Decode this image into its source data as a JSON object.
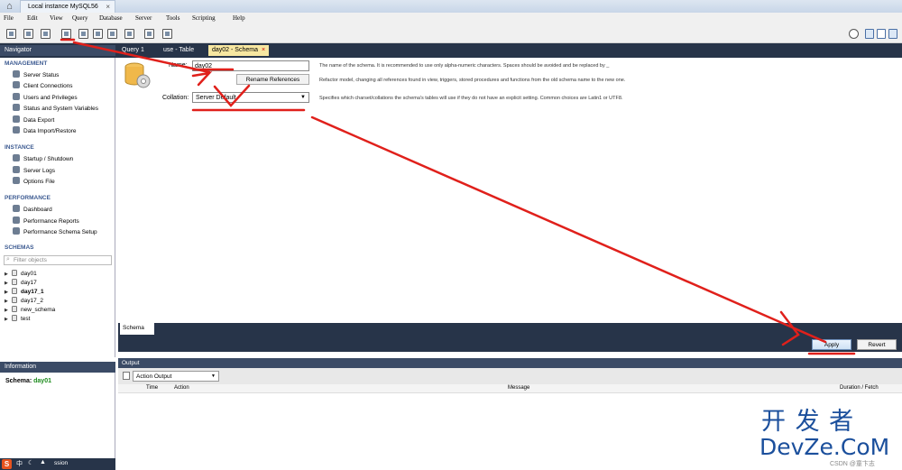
{
  "window": {
    "tab_title": "Local instance MySQL56",
    "close_glyph": "×"
  },
  "menu": [
    "File",
    "Edit",
    "View",
    "Query",
    "Database",
    "Server",
    "Tools",
    "Scripting",
    "Help"
  ],
  "doc_tabs": [
    {
      "label": "Query 1",
      "active": false
    },
    {
      "label": "use - Table",
      "active": false
    },
    {
      "label": "day02 - Schema",
      "active": true
    }
  ],
  "navigator": {
    "title": "Navigator",
    "management": {
      "title": "MANAGEMENT",
      "items": [
        "Server Status",
        "Client Connections",
        "Users and Privileges",
        "Status and System Variables",
        "Data Export",
        "Data Import/Restore"
      ]
    },
    "instance": {
      "title": "INSTANCE",
      "items": [
        "Startup / Shutdown",
        "Server Logs",
        "Options File"
      ]
    },
    "performance": {
      "title": "PERFORMANCE",
      "items": [
        "Dashboard",
        "Performance Reports",
        "Performance Schema Setup"
      ]
    },
    "schemas": {
      "title": "SCHEMAS",
      "filter_placeholder": "Filter objects",
      "items": [
        "day01",
        "day17",
        "day17_1",
        "day17_2",
        "new_schema",
        "test"
      ]
    }
  },
  "info": {
    "title": "Information",
    "schema_label": "Schema:",
    "schema_value": "day01"
  },
  "bottom_nav": {
    "text": "ssion"
  },
  "editor": {
    "name_label": "Name:",
    "name_value": "day02",
    "name_desc": "The name of the schema. It is recommended to use only alpha-numeric characters. Spaces should be avoided and be replaced by _",
    "rename_button": "Rename References",
    "rename_desc": "Refactor model, changing all references found in view, triggers, stored procedures and functions from the old schema name to the new one.",
    "collation_label": "Collation:",
    "collation_value": "Server Default",
    "collation_desc": "Specifies which charset/collations the schema's tables will use if they do not have an explicit setting. Common choices are Latin1 or UTF8."
  },
  "bottom_tabs": {
    "schema_tab": "Schema",
    "apply": "Apply",
    "revert": "Revert"
  },
  "output": {
    "title": "Output",
    "selector": "Action Output",
    "columns": [
      "Time",
      "Action",
      "Message",
      "Duration / Fetch"
    ]
  },
  "watermark": {
    "line1": "开 发 者",
    "line2": "DevZe.CoM",
    "credit": "CSDN @童卞志"
  },
  "ime": {
    "text": "中"
  },
  "colors": {
    "annotation_red": "#e0201b",
    "nav_dark": "#273449",
    "section_blue": "#3c5a91",
    "active_tab": "#f7e7a1",
    "watermark_blue": "#1b4f9c"
  }
}
